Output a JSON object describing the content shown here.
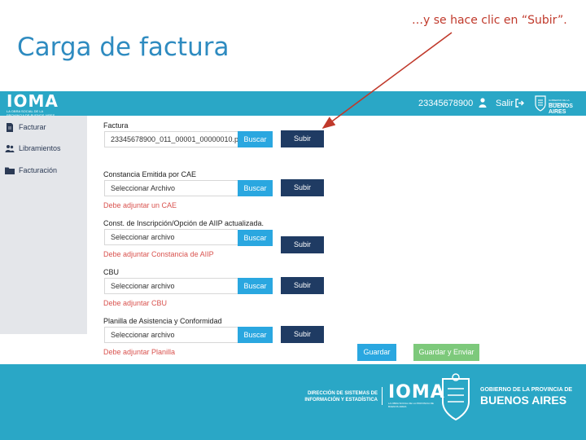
{
  "slide": {
    "title": "Carga de factura",
    "annotation": "…y se hace clic en “Subir”."
  },
  "header": {
    "logo_text": "IOMA",
    "logo_subtext": "LA OBRA SOCIAL DE LA PROVINCIA DE BUENOS AIRES",
    "user_id": "23345678900",
    "logout_label": "Salir",
    "ba_logo_line1": "GOBIERNO DE LA PROVINCIA DE",
    "ba_logo_line2": "BUENOS AIRES"
  },
  "sidebar": {
    "items": [
      {
        "label": "Facturar",
        "icon": "document-icon"
      },
      {
        "label": "Libramientos",
        "icon": "people-icon"
      },
      {
        "label": "Facturación",
        "icon": "folder-icon"
      }
    ]
  },
  "form": {
    "buscar_label": "Buscar",
    "subir_label": "Subir",
    "sections": [
      {
        "label": "Factura",
        "file_value": "23345678900_011_00001_00000010.pdf",
        "warning": ""
      },
      {
        "label": "Constancia Emitida por CAE",
        "file_value": "Seleccionar Archivo",
        "warning": "Debe adjuntar un CAE"
      },
      {
        "label": "Const. de Inscripción/Opción de AIIP actualizada.",
        "file_value": "Seleccionar archivo",
        "warning": "Debe adjuntar Constancia de AIIP"
      },
      {
        "label": "CBU",
        "file_value": "Seleccionar archivo",
        "warning": "Debe adjuntar CBU"
      },
      {
        "label": "Planilla de Asistencia y Conformidad",
        "file_value": "Seleccionar archivo",
        "warning": "Debe adjuntar Planilla"
      }
    ],
    "guardar_label": "Guardar",
    "guardar_enviar_label": "Guardar y Enviar"
  },
  "footer": {
    "direccion_line1": "DIRECCIÓN DE SISTEMAS DE",
    "direccion_line2": "INFORMACIÓN Y ESTADÍSTICA",
    "ioma_text": "IOMA",
    "ioma_subtext": "LA OBRA SOCIAL DE LA PROVINCIA DE BUENOS AIRES",
    "gobierno_line1": "GOBIERNO DE LA PROVINCIA DE",
    "gobierno_line2": "BUENOS AIRES"
  },
  "colors": {
    "brand_teal": "#2aa7c6",
    "title_blue": "#2e8bc0",
    "annotation_red": "#c0392b",
    "subir_navy": "#1f3b63",
    "buscar_blue": "#2aa7e0",
    "warning_red": "#d9534f",
    "guardar_enviar_green": "#7dc97b"
  }
}
